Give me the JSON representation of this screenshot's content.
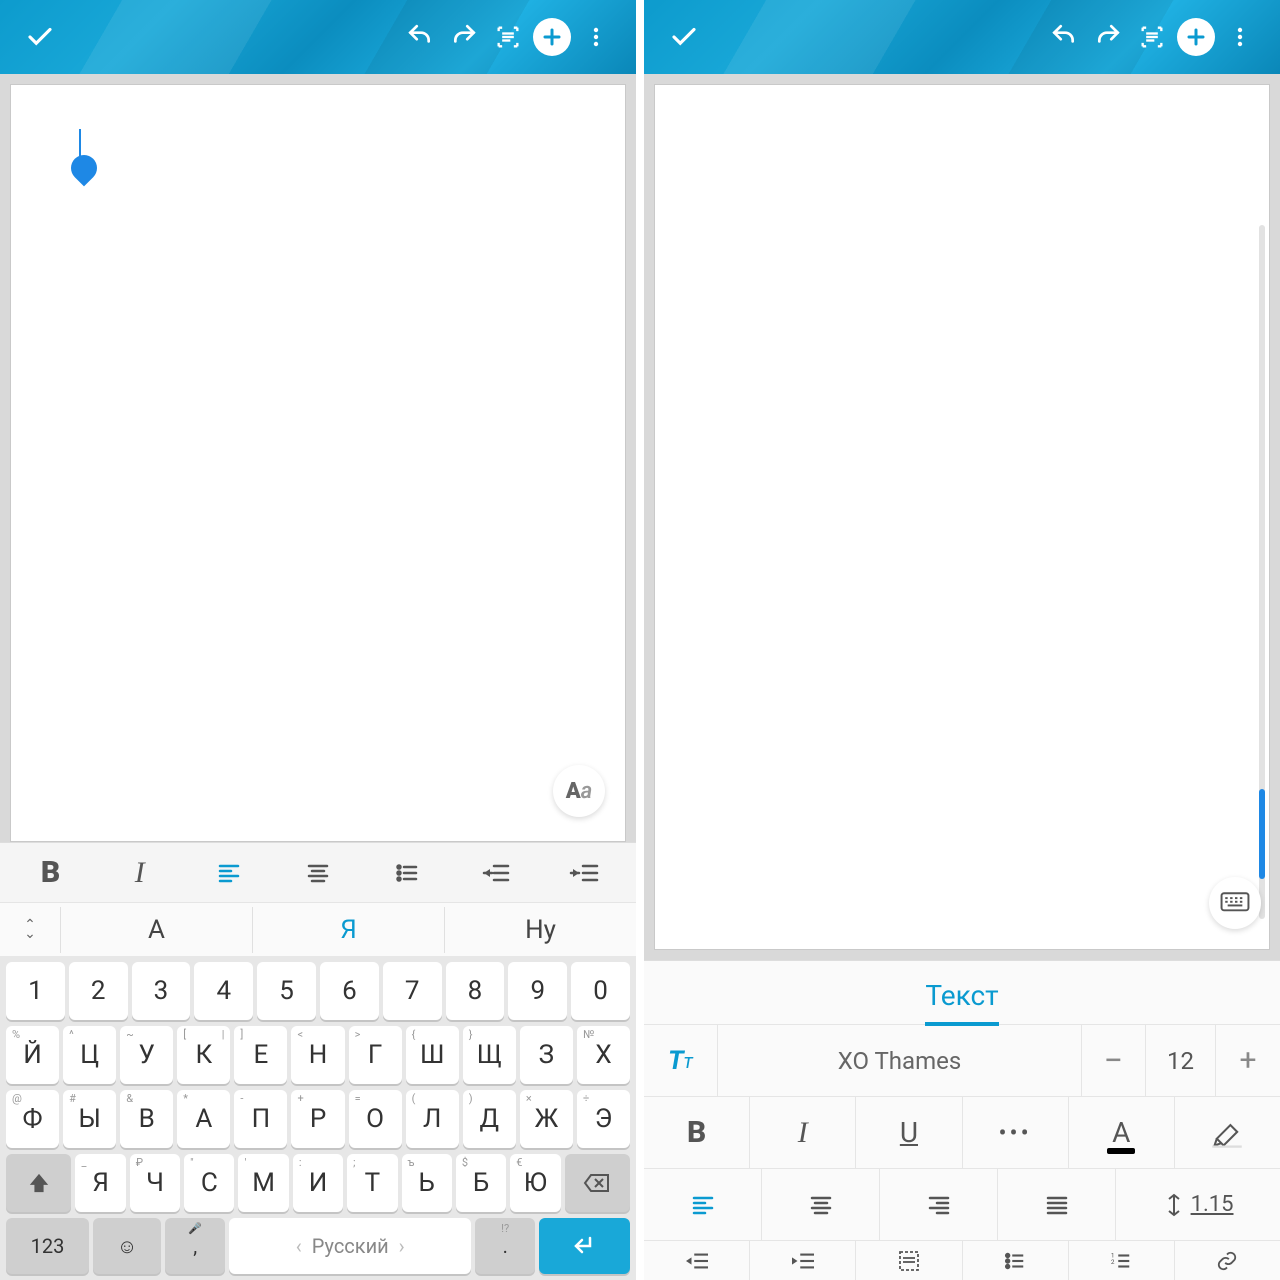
{
  "colors": {
    "accent": "#0a9ad0",
    "text": "#444"
  },
  "left": {
    "floatBtn": "Aa",
    "quickToolbar": [
      "bold",
      "italic",
      "align-left",
      "align-center",
      "list",
      "indent-left",
      "indent-right"
    ],
    "suggestions": {
      "s1": "А",
      "s2": "Я",
      "s3": "Ну"
    },
    "keyboard": {
      "row0": [
        "1",
        "2",
        "3",
        "4",
        "5",
        "6",
        "7",
        "8",
        "9",
        "0"
      ],
      "row1": [
        {
          "m": "Й",
          "l": "%",
          "r": ""
        },
        {
          "m": "Ц",
          "l": "^",
          "r": ""
        },
        {
          "m": "У",
          "l": "~",
          "r": ""
        },
        {
          "m": "К",
          "l": "[",
          "r": "|"
        },
        {
          "m": "Е",
          "l": "]",
          "r": ""
        },
        {
          "m": "Н",
          "l": "<",
          "r": ""
        },
        {
          "m": "Г",
          "l": ">",
          "r": ""
        },
        {
          "m": "Ш",
          "l": "{",
          "r": ""
        },
        {
          "m": "Щ",
          "l": "}",
          "r": ""
        },
        {
          "m": "З",
          "l": "",
          "r": ""
        },
        {
          "m": "Х",
          "l": "№",
          "r": ""
        }
      ],
      "row2": [
        {
          "m": "Ф",
          "l": "@",
          "r": ""
        },
        {
          "m": "Ы",
          "l": "#",
          "r": ""
        },
        {
          "m": "В",
          "l": "&",
          "r": ""
        },
        {
          "m": "А",
          "l": "*",
          "r": ""
        },
        {
          "m": "П",
          "l": "-",
          "r": ""
        },
        {
          "m": "Р",
          "l": "+",
          "r": ""
        },
        {
          "m": "О",
          "l": "=",
          "r": ""
        },
        {
          "m": "Л",
          "l": "(",
          "r": ""
        },
        {
          "m": "Д",
          "l": ")",
          "r": ""
        },
        {
          "m": "Ж",
          "l": "×",
          "r": ""
        },
        {
          "m": "Э",
          "l": "÷",
          "r": ""
        }
      ],
      "row3": [
        {
          "m": "Я",
          "l": "_",
          "r": ""
        },
        {
          "m": "Ч",
          "l": "₽",
          "r": ""
        },
        {
          "m": "С",
          "l": "\"",
          "r": ""
        },
        {
          "m": "М",
          "l": "'",
          "r": ""
        },
        {
          "m": "И",
          "l": ":",
          "r": ""
        },
        {
          "m": "Т",
          "l": ";",
          "r": ""
        },
        {
          "m": "Ь",
          "l": "ъ",
          "r": ""
        },
        {
          "m": "Б",
          "l": "$",
          "r": ""
        },
        {
          "m": "Ю",
          "l": "€",
          "r": ""
        }
      ],
      "bottom": {
        "sym": "123",
        "lang": "Русский",
        "dot": ".",
        "comma": ",",
        "qm": "!?"
      }
    }
  },
  "right": {
    "panelTitle": "Текст",
    "font": {
      "name": "XO Thames",
      "size": "12"
    },
    "lineSpacing": "1.15"
  }
}
